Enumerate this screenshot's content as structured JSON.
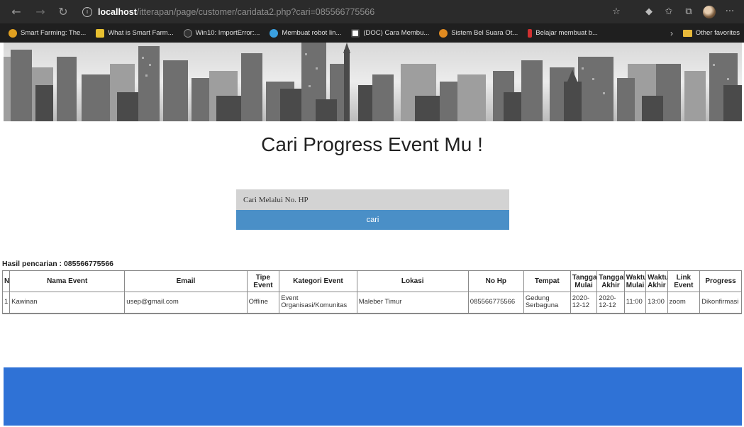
{
  "browser": {
    "url_host": "localhost",
    "url_path": "/itterapan/page/customer/caridata2.php?cari=085566775566",
    "bookmarks": [
      {
        "label": "Smart Farming: The...",
        "color": "#e0a020"
      },
      {
        "label": "What is Smart Farm...",
        "color": "#e8c030"
      },
      {
        "label": "Win10: ImportError:...",
        "color": "#333333"
      },
      {
        "label": "Membuat robot lin...",
        "color": "#3aa0e0"
      },
      {
        "label": "(DOC) Cara Membu...",
        "color": "#ffffff"
      },
      {
        "label": "Sistem Bel Suara Ot...",
        "color": "#e08a20"
      },
      {
        "label": "Belajar membuat b...",
        "color": "#d03030"
      }
    ],
    "bookmarks_more": "›",
    "other_favorites": "Other favorites"
  },
  "page": {
    "title": "Cari Progress Event Mu !",
    "search": {
      "placeholder": "Cari Melalui No. HP",
      "button_label": "cari"
    },
    "result_label": "Hasil pencarian : 085566775566",
    "table": {
      "headers": [
        "No",
        "Nama Event",
        "Email",
        "Tipe Event",
        "Kategori Event",
        "Lokasi",
        "No Hp",
        "Tempat",
        "Tanggal Mulai",
        "Tanggal Akhir",
        "Waktu Mulai",
        "Waktu Akhir",
        "Link Event",
        "Progress"
      ],
      "rows": [
        [
          "1",
          "Kawinan",
          "usep@gmail.com",
          "Offline",
          "Event Organisasi/Komunitas",
          "Maleber Timur",
          "085566775566",
          "Gedung Serbaguna",
          "2020-12-12",
          "2020-12-12",
          "11:00",
          "13:00",
          "zoom",
          "Dikonfirmasi"
        ]
      ]
    }
  },
  "colors": {
    "search_button": "#4a8fc7",
    "search_input": "#d3d3d3",
    "footer": "#2f72d6"
  }
}
